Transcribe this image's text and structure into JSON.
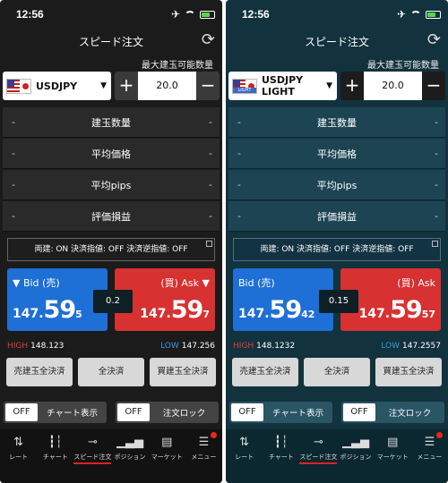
{
  "status": {
    "time": "12:56"
  },
  "screens": [
    {
      "title": "スピード注文",
      "max_label": "最大建玉可能数量",
      "pair": "USDJPY",
      "quantity": "20.0",
      "rows": [
        "建玉数量",
        "平均価格",
        "平均pips",
        "評価損益"
      ],
      "dash": "-",
      "settings": "両建: ON  決済指値: OFF  決済逆指値: OFF",
      "bid": {
        "label": "▼ Bid (売)",
        "p1": "147.",
        "p2": "59",
        "p3": "5"
      },
      "ask": {
        "label": "(買) Ask ▼",
        "p1": "147.",
        "p2": "59",
        "p3": "7"
      },
      "spread": "0.2",
      "high_label": "HIGH",
      "high": "148.123",
      "low_label": "LOW",
      "low": "147.256",
      "actions": [
        "売建玉全決済",
        "全決済",
        "買建玉全決済"
      ],
      "toggles": [
        {
          "state": "OFF",
          "label": "チャート表示"
        },
        {
          "state": "OFF",
          "label": "注文ロック"
        }
      ],
      "tabs": [
        "レート",
        "チャート",
        "スピード注文",
        "ポジション",
        "マーケット",
        "メニュー"
      ]
    },
    {
      "title": "スピード注文",
      "max_label": "最大建玉可能数量",
      "pair": "USDJPY LIGHT",
      "badge": "LIGHT",
      "quantity": "20.0",
      "rows": [
        "建玉数量",
        "平均価格",
        "平均pips",
        "評価損益"
      ],
      "dash": "-",
      "settings": "両建: ON  決済指値: OFF  決済逆指値: OFF",
      "bid": {
        "label": "Bid (売)",
        "p1": "147.",
        "p2": "59",
        "p3": "42"
      },
      "ask": {
        "label": "(買) Ask",
        "p1": "147.",
        "p2": "59",
        "p3": "57"
      },
      "spread": "0.15",
      "high_label": "HIGH",
      "high": "148.1232",
      "low_label": "LOW",
      "low": "147.2557",
      "actions": [
        "売建玉全決済",
        "全決済",
        "買建玉全決済"
      ],
      "toggles": [
        {
          "state": "OFF",
          "label": "チャート表示"
        },
        {
          "state": "OFF",
          "label": "注文ロック"
        }
      ],
      "tabs": [
        "レート",
        "チャート",
        "スピード注文",
        "ポジション",
        "マーケット",
        "メニュー"
      ]
    }
  ],
  "icons": [
    "airplane-icon",
    "wifi-icon",
    "battery-icon",
    "refresh-icon",
    "caret-down-icon",
    "external-link-icon"
  ],
  "colors": {
    "bid": "#1e6fd6",
    "ask": "#d73131",
    "high": "#e23c3c",
    "low": "#3c9be2",
    "light_bg": "#12323d"
  }
}
